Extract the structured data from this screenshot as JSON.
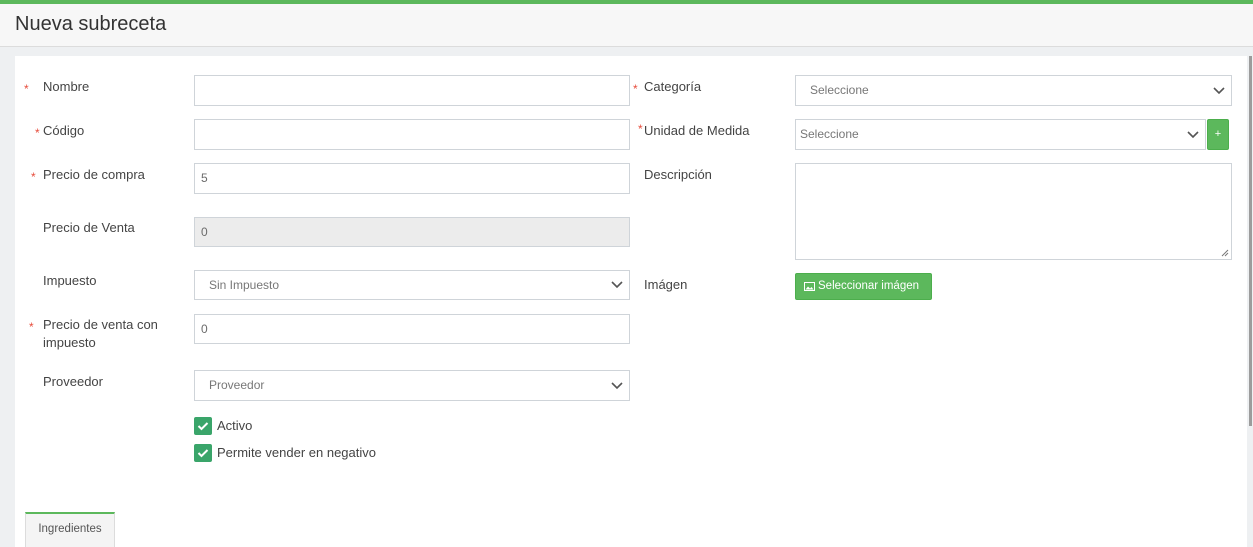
{
  "page": {
    "title": "Nueva subreceta"
  },
  "form": {
    "nombre": {
      "label": "Nombre",
      "value": ""
    },
    "codigo": {
      "label": "Código",
      "value": ""
    },
    "precio_compra": {
      "label": "Precio de compra",
      "value": "5"
    },
    "precio_venta": {
      "label": "Precio de Venta",
      "value": "0"
    },
    "impuesto": {
      "label": "Impuesto",
      "selected": "Sin Impuesto"
    },
    "precio_venta_impuesto": {
      "label_line1": "Precio de venta con",
      "label_line2": "impuesto",
      "value": "0"
    },
    "proveedor": {
      "label": "Proveedor",
      "selected": "Proveedor"
    },
    "categoria": {
      "label": "Categoría",
      "selected": "Seleccione"
    },
    "unidad_medida": {
      "label": "Unidad de Medida",
      "selected": "Seleccione",
      "add_label": "+"
    },
    "descripcion": {
      "label": "Descripción",
      "value": ""
    },
    "imagen": {
      "label": "Imágen",
      "button_label": "Seleccionar imágen"
    },
    "activo": {
      "label": "Activo",
      "checked": true
    },
    "negativo": {
      "label": "Permite vender en negativo",
      "checked": true
    },
    "required_mark": "*"
  },
  "tabs": [
    {
      "label": "Ingredientes"
    }
  ],
  "colors": {
    "accent": "#5cb85c",
    "required": "#e74c3c",
    "checkbox": "#3aa56a"
  }
}
